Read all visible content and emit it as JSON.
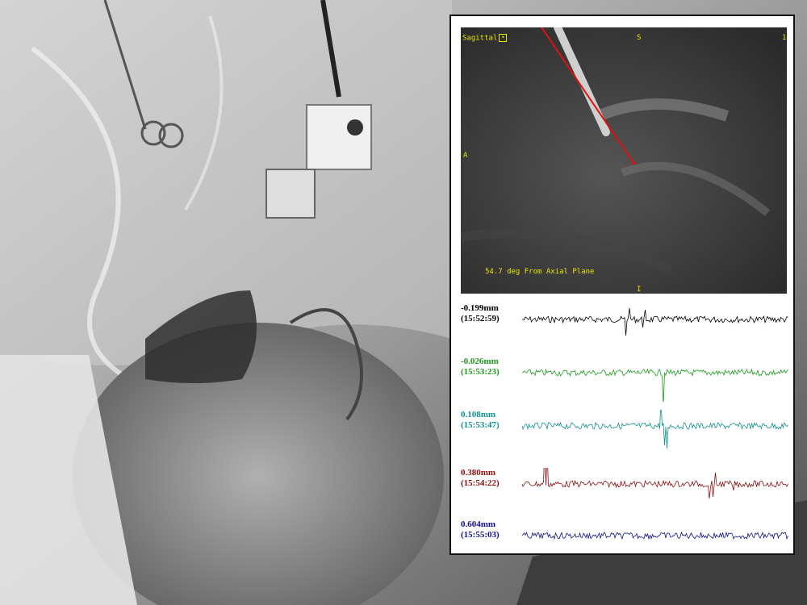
{
  "mri": {
    "view_label": "Sagittal",
    "dropdown_symbol": "▾",
    "label_top": "S",
    "label_top_right": "1",
    "label_left": "A",
    "label_bottom": "I",
    "angle_text": "54.7 deg From Axial Plane"
  },
  "traces": [
    {
      "depth": "-0.199mm",
      "time": "(15:52:59)",
      "color": "#000000"
    },
    {
      "depth": "-0.026mm",
      "time": "(15:53:23)",
      "color": "#1a9a1a"
    },
    {
      "depth": "0.108mm",
      "time": "(15:53:47)",
      "color": "#128f8f"
    },
    {
      "depth": "0.380mm",
      "time": "(15:54:22)",
      "color": "#8a0e0e"
    },
    {
      "depth": "0.604mm",
      "time": "(15:55:03)",
      "color": "#10108a"
    }
  ]
}
